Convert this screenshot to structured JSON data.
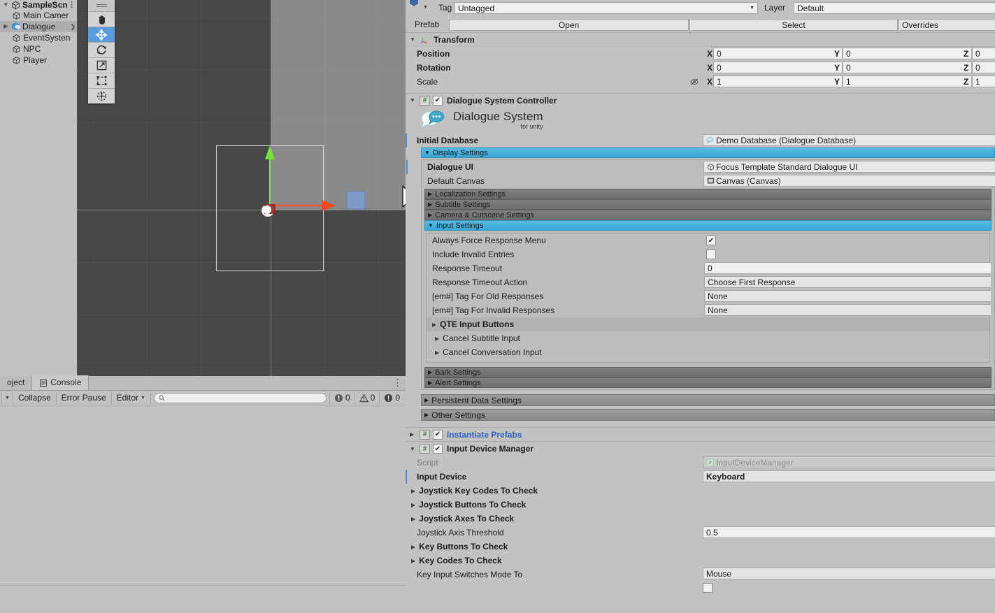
{
  "hierarchy": {
    "scene_name": "SampleScn",
    "items": [
      {
        "label": "Main Camer",
        "icon": "gameobject-icon",
        "indent": 1,
        "expandable": false,
        "selected": false
      },
      {
        "label": "Dialogue",
        "icon": "prefab-icon",
        "indent": 1,
        "expandable": true,
        "selected": true,
        "has_arrow": true
      },
      {
        "label": "EventSysten",
        "icon": "gameobject-icon",
        "indent": 1,
        "expandable": false,
        "selected": false
      },
      {
        "label": "NPC",
        "icon": "gameobject-icon",
        "indent": 1,
        "expandable": false,
        "selected": false
      },
      {
        "label": "Player",
        "icon": "gameobject-icon",
        "indent": 1,
        "expandable": false,
        "selected": false
      }
    ]
  },
  "scene_view": {
    "tools": [
      {
        "name": "hand-tool",
        "icon": "hand-icon",
        "active": false
      },
      {
        "name": "move-tool",
        "icon": "move-icon",
        "active": true
      },
      {
        "name": "rotate-tool",
        "icon": "rotate-icon",
        "active": false
      },
      {
        "name": "scale-tool",
        "icon": "scale-icon",
        "active": false
      },
      {
        "name": "rect-tool",
        "icon": "rect-transform-icon",
        "active": false
      },
      {
        "name": "transform-tool",
        "icon": "transform-icon",
        "active": false
      }
    ],
    "gizmo": {
      "type": "move",
      "x_axis_color": "#f04a23",
      "y_axis_color": "#76e33a",
      "plane_handle_color": "#7f9bd4"
    }
  },
  "console": {
    "tabs": [
      {
        "label": "oject",
        "active": false,
        "icon": "project-icon"
      },
      {
        "label": "Console",
        "active": true,
        "icon": "console-icon"
      }
    ],
    "buttons": [
      {
        "label": "Collapse"
      },
      {
        "label": "Error Pause"
      },
      {
        "label": "Editor",
        "has_caret": true
      }
    ],
    "search_placeholder": "",
    "counts": {
      "log": "0",
      "warning": "0",
      "error": "0"
    }
  },
  "inspector": {
    "tag_label": "Tag",
    "tag_value": "Untagged",
    "layer_label": "Layer",
    "layer_value": "Default",
    "prefab_label": "Prefab",
    "prefab_open": "Open",
    "prefab_select": "Select",
    "prefab_overrides": "Overrides",
    "transform": {
      "title": "Transform",
      "rows": [
        {
          "label": "Position",
          "bold": true,
          "x": "0",
          "y": "0",
          "z": "0",
          "has_eye": false
        },
        {
          "label": "Rotation",
          "bold": true,
          "x": "0",
          "y": "0",
          "z": "0",
          "has_eye": false
        },
        {
          "label": "Scale",
          "bold": false,
          "x": "1",
          "y": "1",
          "z": "1",
          "has_eye": true
        }
      ],
      "axis_labels": [
        "X",
        "Y",
        "Z"
      ]
    },
    "dsc": {
      "title": "Dialogue System Controller",
      "enabled": true,
      "logo_title": "Dialogue System",
      "logo_subtitle": "for unity",
      "initial_database_label": "Initial Database",
      "initial_database_value": "Demo Database (Dialogue Database)",
      "display_settings": {
        "label": "Display Settings",
        "expanded": true,
        "dialogue_ui_label": "Dialogue UI",
        "dialogue_ui_value": "Focus Template Standard Dialogue UI",
        "default_canvas_label": "Default Canvas",
        "default_canvas_value": "Canvas (Canvas)",
        "subgroups": [
          {
            "label": "Localization Settings",
            "expanded": false
          },
          {
            "label": "Subtitle Settings",
            "expanded": false
          },
          {
            "label": "Camera & Cutscene Settings",
            "expanded": false
          },
          {
            "label": "Input Settings",
            "expanded": true
          }
        ],
        "input_settings": {
          "properties": [
            {
              "label": "Always Force Response Menu",
              "type": "checkbox",
              "value": true
            },
            {
              "label": "Include Invalid Entries",
              "type": "checkbox",
              "value": false
            },
            {
              "label": "Response Timeout",
              "type": "text",
              "value": "0"
            },
            {
              "label": "Response Timeout Action",
              "type": "dropdown",
              "value": "Choose First Response"
            },
            {
              "label": "[em#] Tag For Old Responses",
              "type": "dropdown",
              "value": "None"
            },
            {
              "label": "[em#] Tag For Invalid Responses",
              "type": "dropdown",
              "value": "None"
            }
          ],
          "foldouts": [
            {
              "label": "QTE Input Buttons",
              "bold": true,
              "highlight": true
            },
            {
              "label": "Cancel Subtitle Input",
              "bold": false,
              "highlight": false
            },
            {
              "label": "Cancel Conversation Input",
              "bold": false,
              "highlight": false
            }
          ]
        },
        "trailing_subgroups": [
          {
            "label": "Bark Settings",
            "expanded": false
          },
          {
            "label": "Alert Settings",
            "expanded": false
          }
        ]
      },
      "sections": [
        {
          "label": "Persistent Data Settings",
          "expanded": false
        },
        {
          "label": "Other Settings",
          "expanded": false
        }
      ]
    },
    "instantiate_prefabs": {
      "title": "Instantiate Prefabs",
      "enabled": true,
      "expanded": false
    },
    "input_device_manager": {
      "title": "Input Device Manager",
      "enabled": true,
      "expanded": true,
      "script_label": "Script",
      "script_value": "InputDeviceManager",
      "properties": [
        {
          "label": "Input Device",
          "bold": true,
          "type": "dropdown",
          "value": "Keyboard",
          "marker": true
        },
        {
          "label": "Joystick Key Codes To Check",
          "bold": true,
          "type": "foldout",
          "value": ""
        },
        {
          "label": "Joystick Buttons To Check",
          "bold": true,
          "type": "foldout",
          "value": ""
        },
        {
          "label": "Joystick Axes To Check",
          "bold": true,
          "type": "foldout",
          "value": ""
        },
        {
          "label": "Joystick Axis Threshold",
          "bold": false,
          "type": "text",
          "value": "0.5"
        },
        {
          "label": "Key Buttons To Check",
          "bold": true,
          "type": "foldout",
          "value": ""
        },
        {
          "label": "Key Codes To Check",
          "bold": true,
          "type": "foldout",
          "value": ""
        },
        {
          "label": "Key Input Switches Mode To",
          "bold": false,
          "type": "dropdown",
          "value": "Mouse"
        }
      ]
    }
  },
  "colors": {
    "panel_bg": "#c2c2c2",
    "scene_bg": "#474747",
    "accent_blue": "#36a7da",
    "selection_blue": "#5b9bdd",
    "link_blue": "#2c5fbe",
    "marker_blue": "#4b8fd4"
  }
}
